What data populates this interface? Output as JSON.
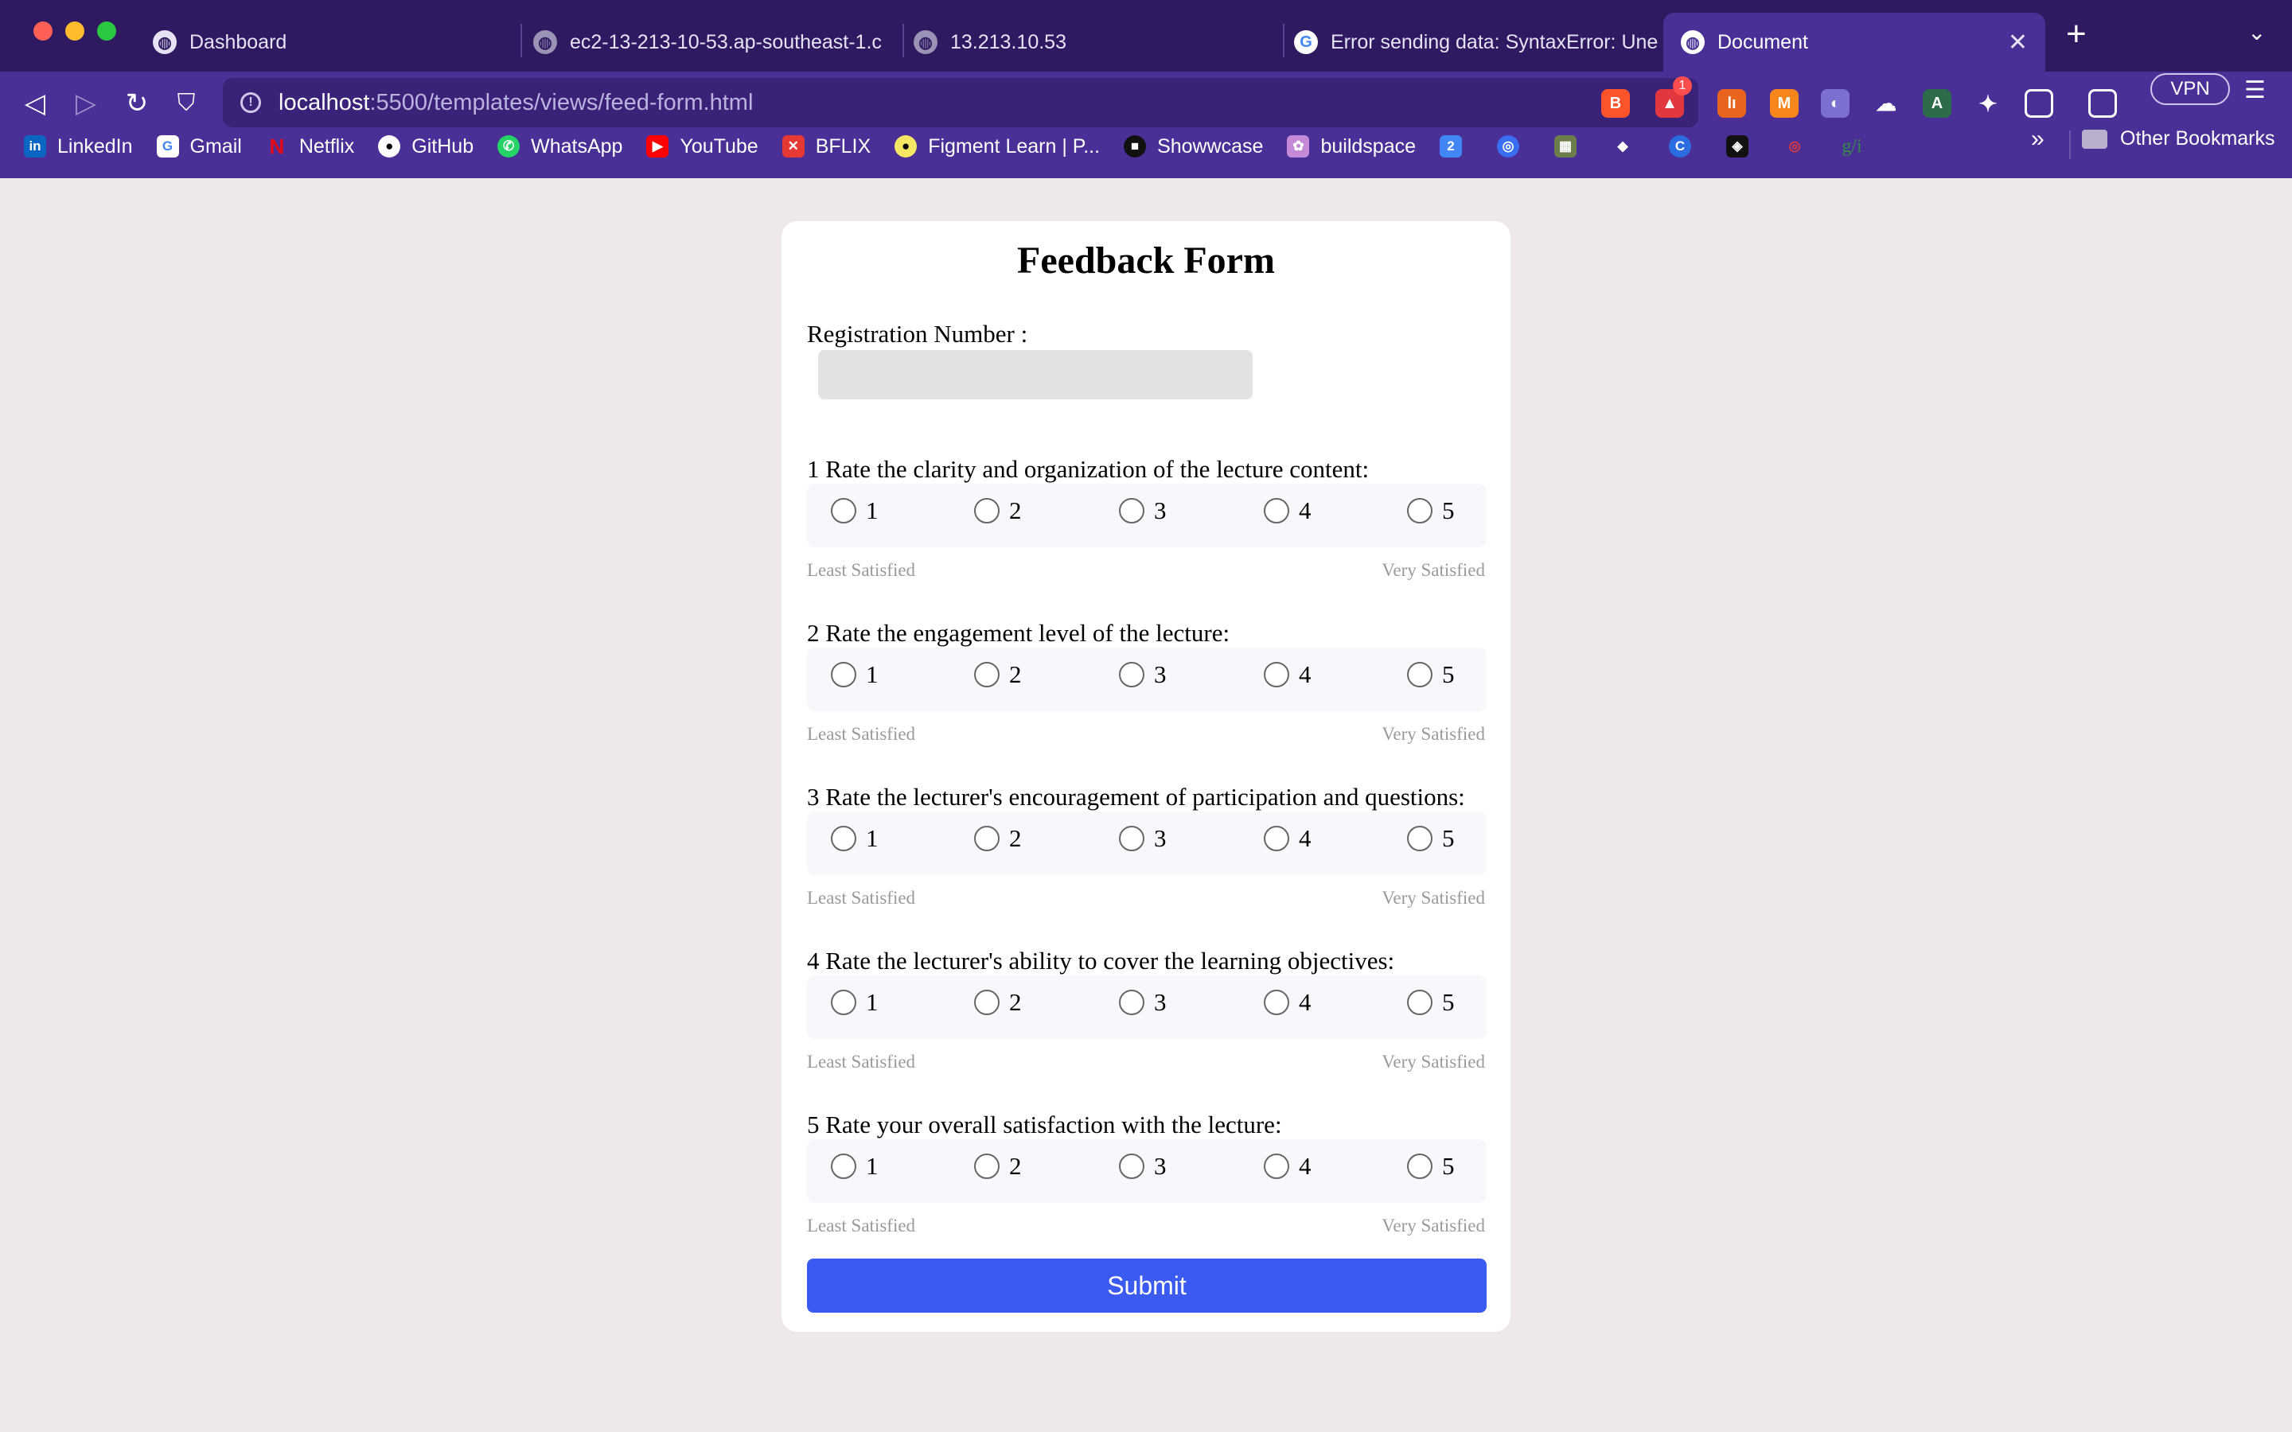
{
  "browser": {
    "tabs": [
      {
        "title": "Dashboard",
        "active": false
      },
      {
        "title": "ec2-13-213-10-53.ap-southeast-1.c",
        "active": false
      },
      {
        "title": "13.213.10.53",
        "active": false
      },
      {
        "title": "Error sending data: SyntaxError: Une",
        "active": false
      },
      {
        "title": "Document",
        "active": true
      }
    ],
    "url": {
      "host": "localhost",
      "path": ":5500/templates/views/feed-form.html"
    },
    "shields_badge": "1",
    "vpn_label": "VPN",
    "bookmarks": [
      {
        "label": "LinkedIn",
        "icon": "linkedin-icon",
        "color": "#0a66c2"
      },
      {
        "label": "Gmail",
        "icon": "google-icon",
        "color": "#ffffff"
      },
      {
        "label": "Netflix",
        "icon": "netflix-icon",
        "color": "#e50914"
      },
      {
        "label": "GitHub",
        "icon": "github-icon",
        "color": "#ffffff"
      },
      {
        "label": "WhatsApp",
        "icon": "whatsapp-icon",
        "color": "#25d366"
      },
      {
        "label": "YouTube",
        "icon": "youtube-icon",
        "color": "#ff0000"
      },
      {
        "label": "BFLIX",
        "icon": "bflix-icon",
        "color": "#e53935"
      },
      {
        "label": "Figment Learn | P...",
        "icon": "figment-icon",
        "color": "#f5e663"
      },
      {
        "label": "Showwcase",
        "icon": "showwcase-icon",
        "color": "#111111"
      },
      {
        "label": "buildspace",
        "icon": "buildspace-icon",
        "color": "#c48ad8"
      }
    ],
    "other_bookmarks": "Other Bookmarks"
  },
  "form": {
    "title": "Feedback Form",
    "registration_label": "Registration Number :",
    "registration_value": "",
    "scale_min_label": "Least Satisfied",
    "scale_max_label": "Very Satisfied",
    "options": [
      "1",
      "2",
      "3",
      "4",
      "5"
    ],
    "questions": [
      {
        "text": "1 Rate the clarity and organization of the lecture content:"
      },
      {
        "text": "2 Rate the engagement level of the lecture:"
      },
      {
        "text": "3 Rate the lecturer's encouragement of participation and questions:"
      },
      {
        "text": "4 Rate the lecturer's ability to cover the learning objectives:"
      },
      {
        "text": "5 Rate your overall satisfaction with the lecture:"
      }
    ],
    "submit_label": "Submit",
    "accent_color": "#3b5bf0"
  }
}
